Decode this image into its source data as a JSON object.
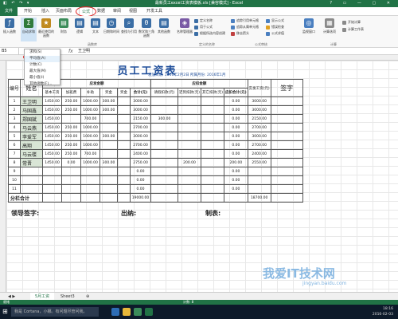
{
  "window": {
    "title": "最新员工excel工资表模板.xls [兼容模式] - Excel",
    "qat": "◧ ↶ ↷ ▾",
    "controls": "?  ▭  —  ▢  ✕"
  },
  "tabs": [
    "文件",
    "开始",
    "插入",
    "页面布局",
    "公式",
    "数据",
    "审阅",
    "视图",
    "开发工具"
  ],
  "ribbon": {
    "buttons": [
      "插入函数",
      "自动求和",
      "最近使用的函数",
      "财务",
      "逻辑",
      "文本",
      "日期和时间",
      "查找与引用",
      "数学和三角函数",
      "其他函数",
      "名称管理器",
      "计算选项"
    ],
    "small": [
      "定义名称",
      "用于公式",
      "根据所选内容创建",
      "追踪引用单元格",
      "追踪从属单元格",
      "移去箭头",
      "显示公式",
      "错误检查",
      "公式求值",
      "监视窗口",
      "开始计算",
      "计算工作表"
    ],
    "groups": [
      "函数库",
      "定义的名称",
      "公式审核",
      "计算"
    ]
  },
  "namebox": "B5",
  "formula": "王卫明",
  "autosum_menu": [
    "求和(S)",
    "平均值(A)",
    "计数(C)",
    "最大值(M)",
    "最小值(I)",
    "其他函数(F)..."
  ],
  "sheet": {
    "title": "员工工资表",
    "date_info": "发放日期: 2016年2月2日    所属月份: 2016年1月",
    "hdr": {
      "no": "编号",
      "name": "姓名",
      "earn": "应发金额",
      "ded": "应扣金额",
      "actual": "实发工资(元)",
      "sign": "签字"
    },
    "subhdr": [
      "基本工资",
      "加班费",
      "补助",
      "奖金",
      "奖金",
      "合计(元)",
      "请假扣款(元)",
      "迟到扣款(元)",
      "其它扣款(元)",
      "应扣合计(元)"
    ],
    "rows": [
      [
        "1",
        "王卫明",
        "1450.00",
        "250.00",
        "1000.00",
        "300.00",
        "",
        "3000.00",
        "",
        "",
        "",
        "0.00",
        "3000.00"
      ],
      [
        "2",
        "马国鑫",
        "1450.00",
        "250.00",
        "1000.00",
        "300.00",
        "",
        "3000.00",
        "",
        "",
        "",
        "0.00",
        "3000.00"
      ],
      [
        "3",
        "郑国斌",
        "1450.00",
        "",
        "700.00",
        "",
        "",
        "2150.00",
        "300.00",
        "",
        "",
        "0.00",
        "2150.00"
      ],
      [
        "4",
        "马云燕",
        "1450.00",
        "250.00",
        "1000.00",
        "",
        "",
        "2700.00",
        "",
        "",
        "",
        "0.00",
        "2700.00"
      ],
      [
        "5",
        "李爱军",
        "1450.00",
        "250.00",
        "1000.00",
        "300.00",
        "",
        "3000.00",
        "",
        "",
        "",
        "0.00",
        "3000.00"
      ],
      [
        "6",
        "高翔",
        "1450.00",
        "250.00",
        "1000.00",
        "",
        "",
        "2700.00",
        "",
        "",
        "",
        "0.00",
        "2700.00"
      ],
      [
        "7",
        "马云楼",
        "1450.00",
        "250.00",
        "700.00",
        "",
        "",
        "2400.00",
        "",
        "",
        "",
        "0.00",
        "2400.00"
      ],
      [
        "8",
        "常晋",
        "1450.00",
        "0.00",
        "1000.00",
        "300.00",
        "",
        "2750.00",
        "",
        "200.00",
        "",
        "200.00",
        "2550.00"
      ],
      [
        "9",
        "",
        "",
        "",
        "",
        "",
        "",
        "0.00",
        "",
        "",
        "",
        "0.00",
        ""
      ],
      [
        "10",
        "",
        "",
        "",
        "",
        "",
        "",
        "0.00",
        "",
        "",
        "",
        "0.00",
        ""
      ],
      [
        "11",
        "",
        "",
        "",
        "",
        "",
        "",
        "0.00",
        "",
        "",
        "",
        "0.00",
        ""
      ]
    ],
    "total": {
      "label": "分栏合计",
      "earn": "19000.00",
      "actual": "18700.00"
    },
    "sign_labels": [
      "领导签字:",
      "出纳:",
      "制表:"
    ]
  },
  "sheet_tabs": [
    "5月工资",
    "Sheet3"
  ],
  "status": {
    "left": "就绪",
    "right": "计数: 8"
  },
  "taskbar": {
    "search": "我是 Cortana，小娜。有问题尽管问我。",
    "time": "18:16",
    "date": "2016-02-03"
  },
  "watermark": {
    "main": "我爱IT技术网",
    "sub": "jingyan.baidu.com"
  },
  "colors": {
    "excel_green": "#217346",
    "title_blue": "#1f4e9a",
    "highlight": "#e02020"
  }
}
